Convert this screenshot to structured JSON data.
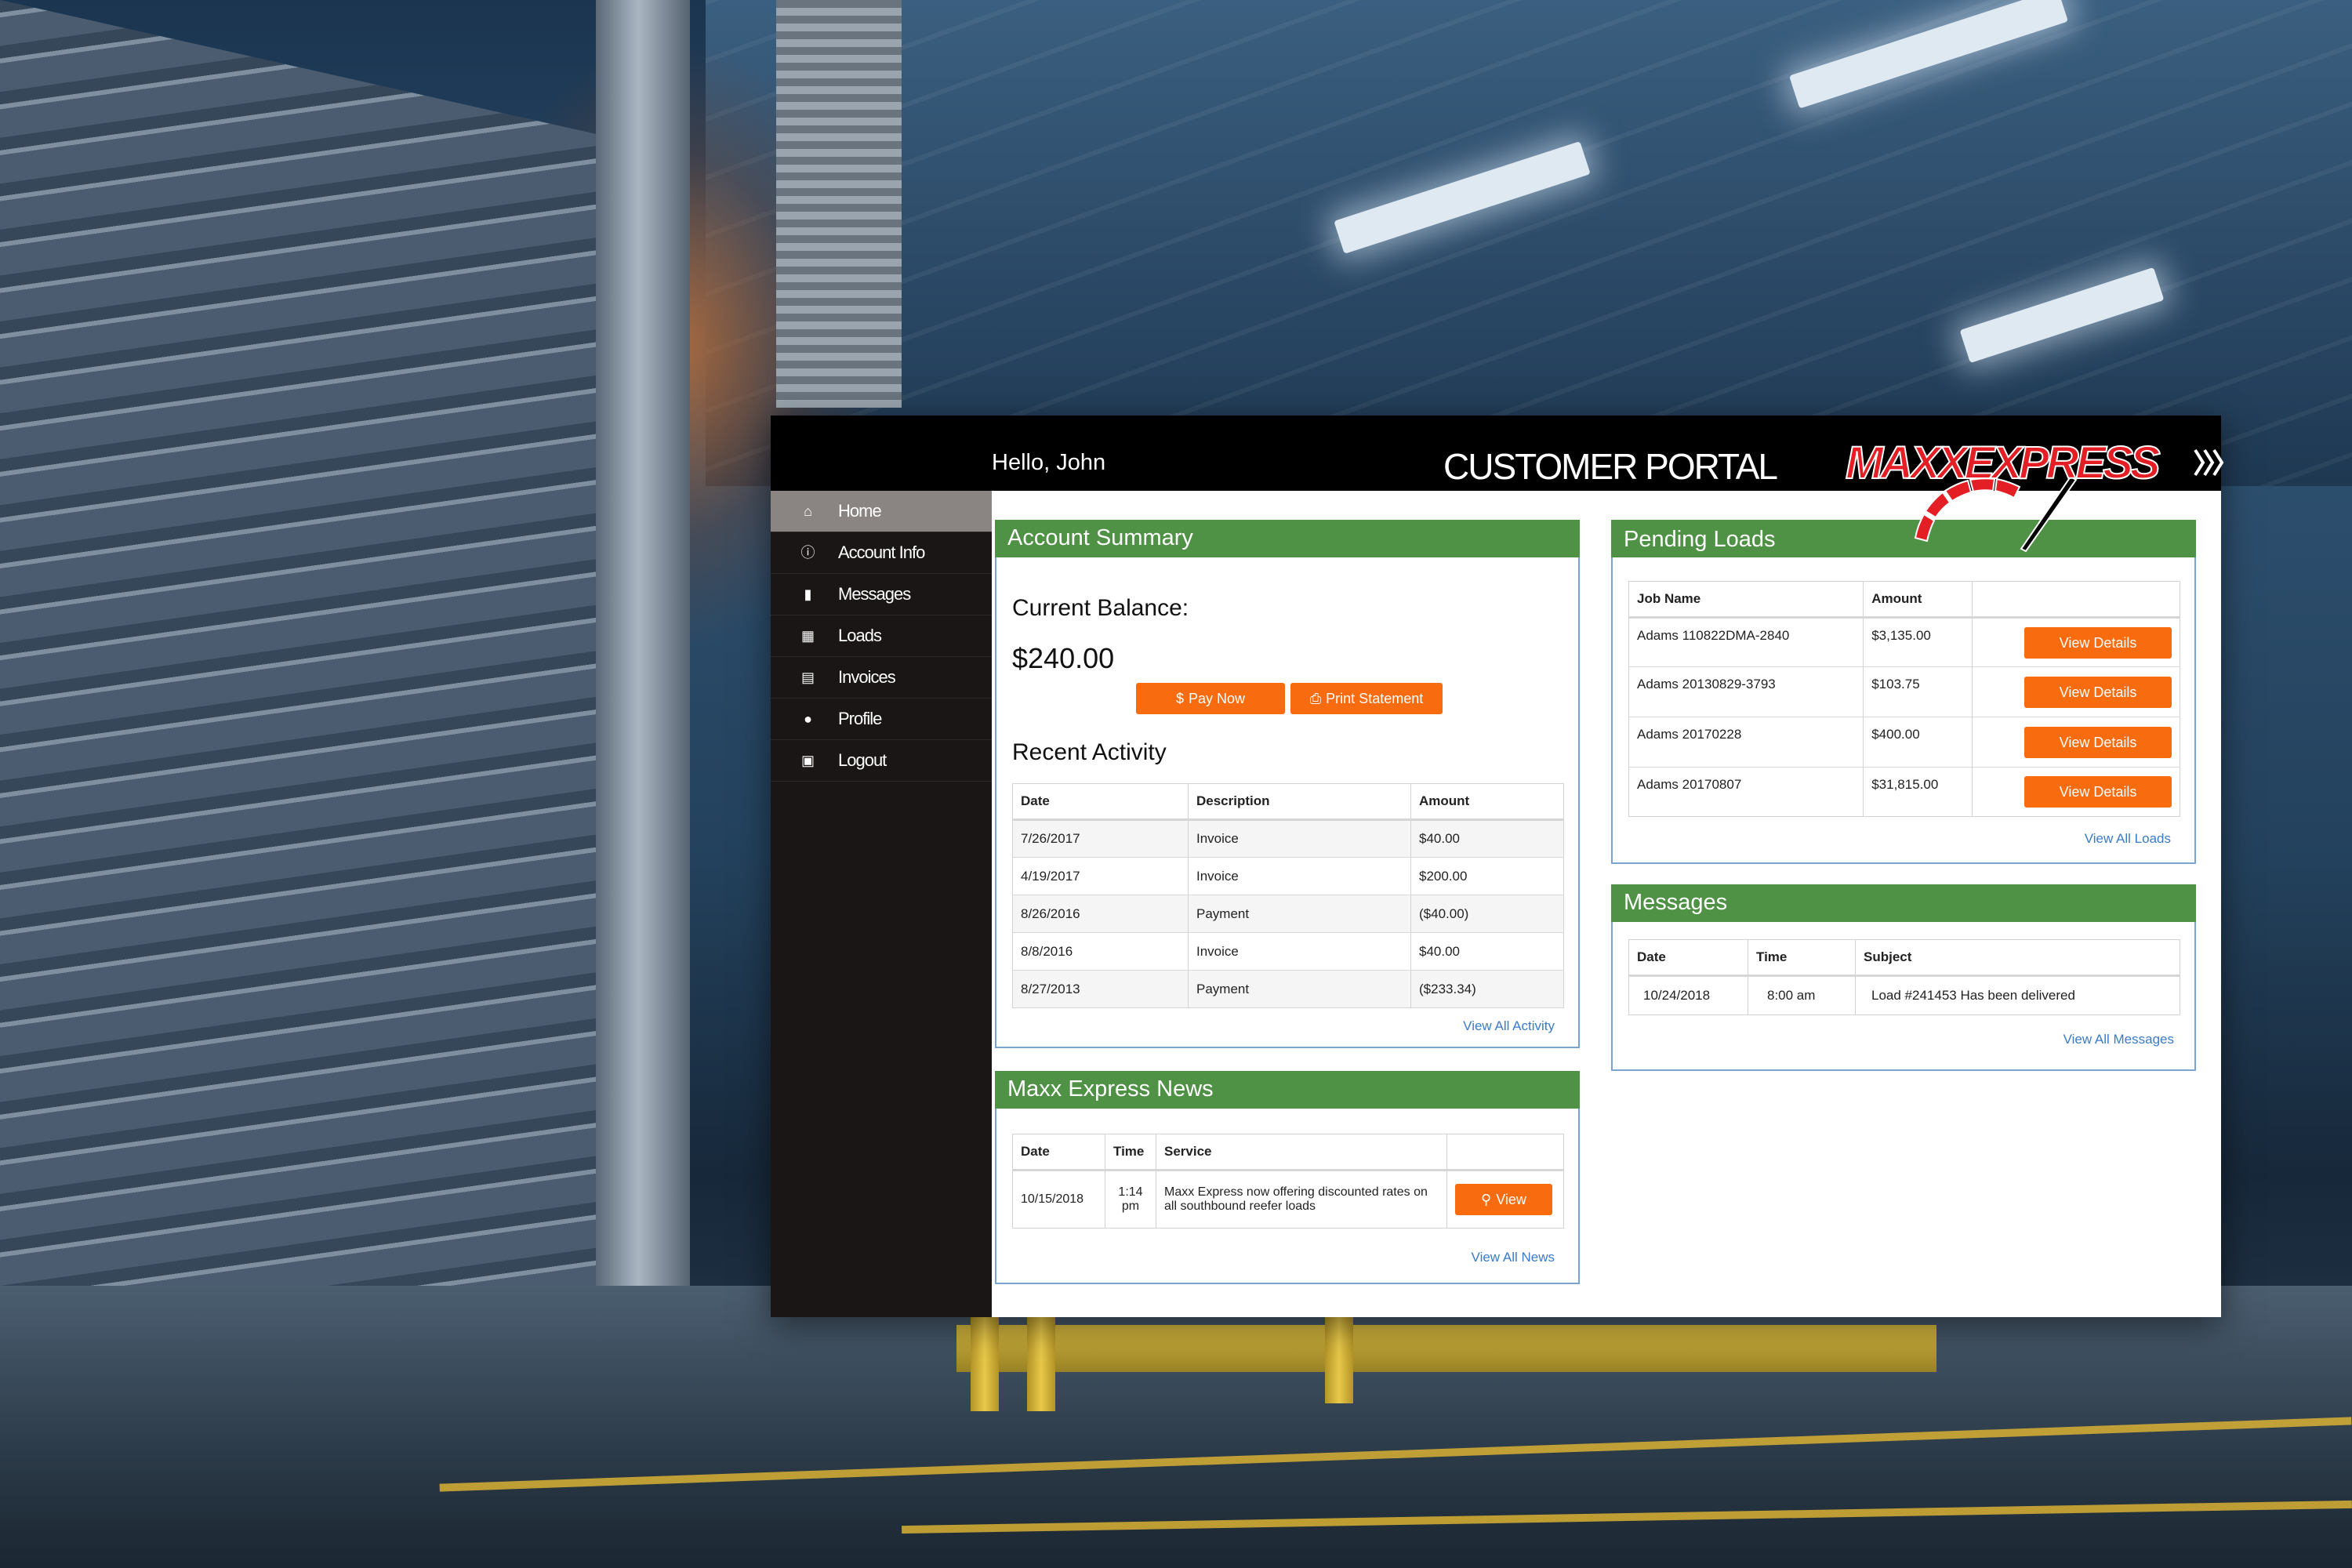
{
  "header": {
    "greeting": "Hello, John",
    "title": "CUSTOMER PORTAL",
    "logo_text": "MAXXEXPRESS"
  },
  "sidebar": {
    "items": [
      {
        "label": "Home",
        "icon": "home-icon",
        "active": true
      },
      {
        "label": "Account Info",
        "icon": "info-icon"
      },
      {
        "label": "Messages",
        "icon": "chat-bubble-icon"
      },
      {
        "label": "Loads",
        "icon": "calendar-icon"
      },
      {
        "label": "Invoices",
        "icon": "list-icon"
      },
      {
        "label": "Profile",
        "icon": "user-icon"
      },
      {
        "label": "Logout",
        "icon": "lock-icon"
      }
    ]
  },
  "account_summary": {
    "title": "Account Summary",
    "balance_label": "Current Balance:",
    "balance_value": "$240.00",
    "pay_now_label": "Pay Now",
    "print_label": "Print Statement",
    "recent_activity_title": "Recent Activity",
    "columns": [
      "Date",
      "Description",
      "Amount"
    ],
    "rows": [
      [
        "7/26/2017",
        "Invoice",
        "$40.00"
      ],
      [
        "4/19/2017",
        "Invoice",
        "$200.00"
      ],
      [
        "8/26/2016",
        "Payment",
        "($40.00)"
      ],
      [
        "8/8/2016",
        "Invoice",
        "$40.00"
      ],
      [
        "8/27/2013",
        "Payment",
        "($233.34)"
      ]
    ],
    "view_all_label": "View All Activity"
  },
  "news": {
    "title": "Maxx Express News",
    "columns": [
      "Date",
      "Time",
      "Service"
    ],
    "rows": [
      [
        "10/15/2018",
        "1:14 pm",
        "Maxx Express now offering discounted rates on all southbound reefer loads"
      ]
    ],
    "view_label": "View",
    "view_all_label": "View All News"
  },
  "pending_loads": {
    "title": "Pending Loads",
    "columns": [
      "Job Name",
      "Amount",
      ""
    ],
    "rows": [
      [
        "Adams 110822DMA-2840",
        "$3,135.00"
      ],
      [
        "Adams 20130829-3793",
        "$103.75"
      ],
      [
        "Adams 20170228",
        "$400.00"
      ],
      [
        "Adams 20170807",
        "$31,815.00"
      ]
    ],
    "details_label": "View Details",
    "view_all_label": "View All Loads"
  },
  "messages": {
    "title": "Messages",
    "columns": [
      "Date",
      "Time",
      "Subject"
    ],
    "rows": [
      [
        "10/24/2018",
        "8:00 am",
        "Load #241453 Has been delivered"
      ]
    ],
    "view_all_label": "View All Messages"
  },
  "colors": {
    "panel_header": "#4f9145",
    "button": "#f86b0f",
    "link": "#3a7bc8",
    "topbar": "#000000",
    "sidebar": "#1a1615"
  }
}
